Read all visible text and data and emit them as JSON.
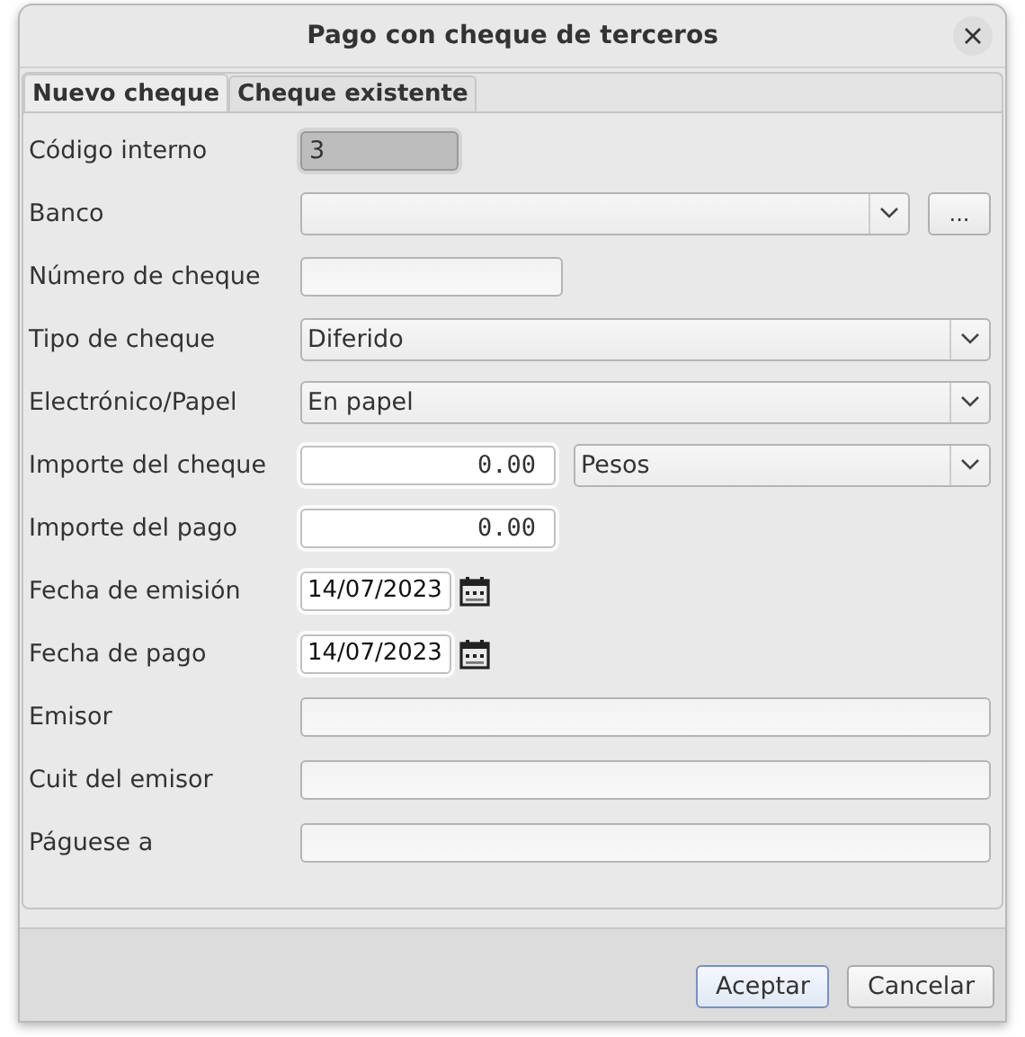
{
  "window": {
    "title": "Pago con cheque de terceros"
  },
  "tabs": [
    {
      "label": "Nuevo cheque",
      "selected": true
    },
    {
      "label": "Cheque existente",
      "selected": false
    }
  ],
  "rows": [
    {
      "label": "Código interno",
      "kind": "readonly",
      "value": "3"
    },
    {
      "label": "Banco",
      "kind": "combo",
      "button": "..."
    },
    {
      "label": "Número de cheque",
      "kind": "short"
    },
    {
      "label": "Tipo de cheque",
      "kind": "combo",
      "value": "Diferido"
    },
    {
      "label": "Electrónico/Papel",
      "kind": "combo",
      "value": "En papel"
    },
    {
      "label": "Importe del cheque",
      "kind": "amount",
      "value": "0.00",
      "currency": "Pesos"
    },
    {
      "label": "Importe del pago",
      "kind": "amount",
      "value": "0.00"
    },
    {
      "label": "Fecha de emisión",
      "kind": "date",
      "value": "14/07/2023"
    },
    {
      "label": "Fecha de pago",
      "kind": "date",
      "value": "14/07/2023"
    },
    {
      "label": "Emisor",
      "kind": "wide"
    },
    {
      "label": "Cuit del emisor",
      "kind": "wide"
    },
    {
      "label": "Páguese a",
      "kind": "wide"
    }
  ],
  "buttons": [
    {
      "label": "Aceptar",
      "default": true
    },
    {
      "label": "Cancelar",
      "default": false
    }
  ]
}
